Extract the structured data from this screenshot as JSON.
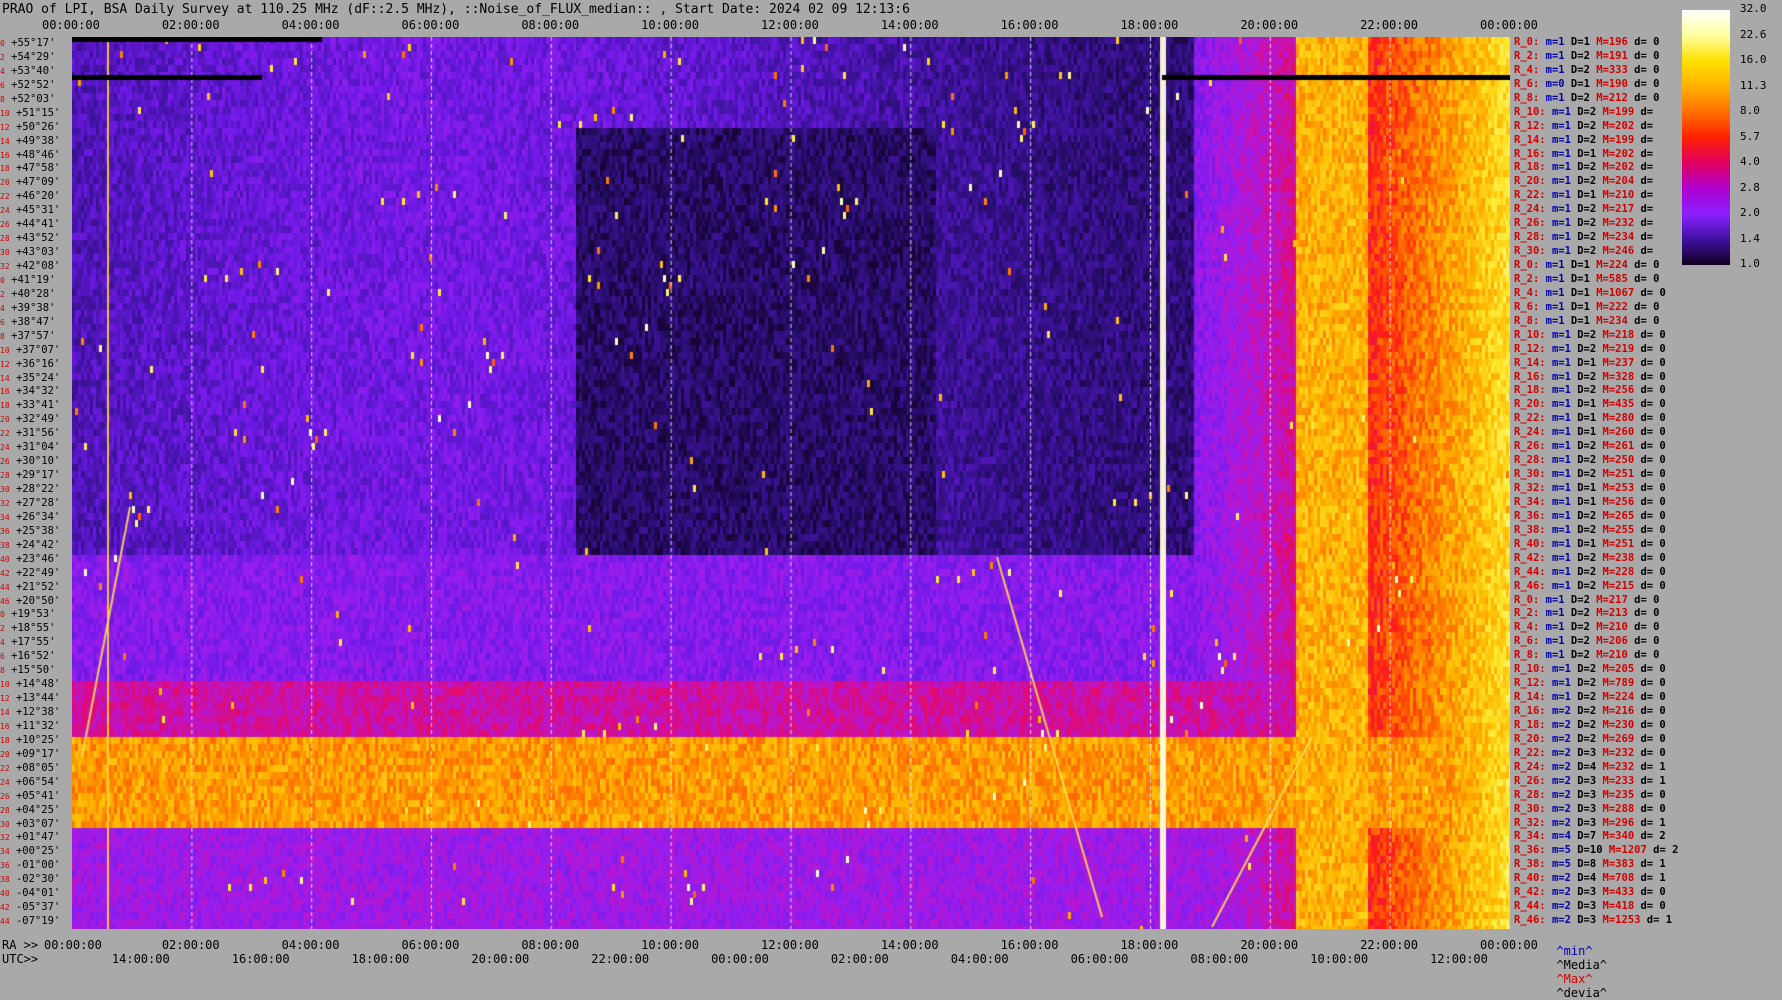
{
  "title": "PRAO of LPI, BSA Daily Survey at 110.25 MHz (dF::2.5 MHz), ::Noise_of_FLUX_median:: , Start Date: 2024 02 09 12:13:6",
  "chart_data": {
    "type": "heatmap",
    "top_axis_ticks": [
      "00:00:00",
      "02:00:00",
      "04:00:00",
      "06:00:00",
      "08:00:00",
      "10:00:00",
      "12:00:00",
      "14:00:00",
      "16:00:00",
      "18:00:00",
      "20:00:00",
      "22:00:00",
      "00:00:00"
    ],
    "bottom_ra_prefix": "RA >>",
    "bottom_ra_ticks": [
      "00:00:00",
      "02:00:00",
      "04:00:00",
      "06:00:00",
      "08:00:00",
      "10:00:00",
      "12:00:00",
      "14:00:00",
      "16:00:00",
      "18:00:00",
      "20:00:00",
      "22:00:00",
      "00:00:00"
    ],
    "bottom_utc_prefix": "UTC>>",
    "bottom_utc_ticks": [
      "14:00:00",
      "16:00:00",
      "18:00:00",
      "20:00:00",
      "22:00:00",
      "00:00:00",
      "02:00:00",
      "04:00:00",
      "06:00:00",
      "08:00:00",
      "10:00:00",
      "12:00:00"
    ],
    "declination_labels": [
      "+55°17'",
      "+54°29'",
      "+53°40'",
      "+52°52'",
      "+52°03'",
      "+51°15'",
      "+50°26'",
      "+49°38'",
      "+48°46'",
      "+47°58'",
      "+47°09'",
      "+46°20'",
      "+45°31'",
      "+44°41'",
      "+43°52'",
      "+43°03'",
      "+42°08'",
      "+41°19'",
      "+40°28'",
      "+39°38'",
      "+38°47'",
      "+37°57'",
      "+37°07'",
      "+36°16'",
      "+35°24'",
      "+34°32'",
      "+33°41'",
      "+32°49'",
      "+31°56'",
      "+31°04'",
      "+30°10'",
      "+29°17'",
      "+28°22'",
      "+27°28'",
      "+26°34'",
      "+25°38'",
      "+24°42'",
      "+23°46'",
      "+22°49'",
      "+21°52'",
      "+20°50'",
      "+19°53'",
      "+18°55'",
      "+17°55'",
      "+16°52'",
      "+15°50'",
      "+14°48'",
      "+13°44'",
      "+12°38'",
      "+11°32'",
      "+10°25'",
      "+09°17'",
      "+08°05'",
      "+06°54'",
      "+05°41'",
      "+04°25'",
      "+03°07'",
      "+01°47'",
      "+00°25'",
      "-01°00'",
      "-02°30'",
      "-04°01'",
      "-05°37'",
      "-07°19'"
    ],
    "row_indices": [
      "0",
      "2",
      "4",
      "6",
      "8",
      "10",
      "12",
      "14",
      "16",
      "18",
      "20",
      "22",
      "24",
      "26",
      "28",
      "30",
      "32",
      "0",
      "2",
      "4",
      "6",
      "8",
      "10",
      "12",
      "14",
      "16",
      "18",
      "20",
      "22",
      "24",
      "26",
      "28",
      "30",
      "32",
      "34",
      "36",
      "38",
      "40",
      "42",
      "44",
      "46",
      "0",
      "2",
      "4",
      "6",
      "8",
      "10",
      "12",
      "14",
      "16",
      "18",
      "20",
      "22",
      "24",
      "26",
      "28",
      "30",
      "32",
      "34",
      "36",
      "38",
      "40",
      "42",
      "44",
      "46"
    ],
    "colorbar_ticks": [
      "32.0",
      "22.6",
      "16.0",
      "11.3",
      "8.0",
      "5.7",
      "4.0",
      "2.8",
      "2.0",
      "1.4",
      "1.0"
    ],
    "colorbar_colors": [
      "#ffffff",
      "#ffffa0",
      "#ffe000",
      "#ffb000",
      "#ff7000",
      "#ff2000",
      "#e00060",
      "#b000d0",
      "#8a20ff",
      "#4010a0",
      "#100020"
    ],
    "stats": [
      {
        "r": "R_0:",
        "m": "m=1",
        "d": "D=1",
        "M": "M=196",
        "dv": "d= 0"
      },
      {
        "r": "R_2:",
        "m": "m=1",
        "d": "D=2",
        "M": "M=191",
        "dv": "d= 0"
      },
      {
        "r": "R_4:",
        "m": "m=1",
        "d": "D=2",
        "M": "M=333",
        "dv": "d= 0"
      },
      {
        "r": "R_6:",
        "m": "m=0",
        "d": "D=1",
        "M": "M=190",
        "dv": "d= 0"
      },
      {
        "r": "R_8:",
        "m": "m=1",
        "d": "D=2",
        "M": "M=212",
        "dv": "d= 0"
      },
      {
        "r": "R_10:",
        "m": "m=1",
        "d": "D=2",
        "M": "M=199",
        "dv": "d="
      },
      {
        "r": "R_12:",
        "m": "m=1",
        "d": "D=2",
        "M": "M=202",
        "dv": "d="
      },
      {
        "r": "R_14:",
        "m": "m=1",
        "d": "D=2",
        "M": "M=199",
        "dv": "d="
      },
      {
        "r": "R_16:",
        "m": "m=1",
        "d": "D=1",
        "M": "M=202",
        "dv": "d="
      },
      {
        "r": "R_18:",
        "m": "m=1",
        "d": "D=2",
        "M": "M=202",
        "dv": "d="
      },
      {
        "r": "R_20:",
        "m": "m=1",
        "d": "D=2",
        "M": "M=204",
        "dv": "d="
      },
      {
        "r": "R_22:",
        "m": "m=1",
        "d": "D=1",
        "M": "M=210",
        "dv": "d="
      },
      {
        "r": "R_24:",
        "m": "m=1",
        "d": "D=2",
        "M": "M=217",
        "dv": "d="
      },
      {
        "r": "R_26:",
        "m": "m=1",
        "d": "D=2",
        "M": "M=232",
        "dv": "d="
      },
      {
        "r": "R_28:",
        "m": "m=1",
        "d": "D=2",
        "M": "M=234",
        "dv": "d="
      },
      {
        "r": "R_30:",
        "m": "m=1",
        "d": "D=2",
        "M": "M=246",
        "dv": "d="
      },
      {
        "r": "R_0:",
        "m": "m=1",
        "d": "D=1",
        "M": "M=224",
        "dv": "d= 0"
      },
      {
        "r": "R_2:",
        "m": "m=1",
        "d": "D=1",
        "M": "M=585",
        "dv": "d= 0"
      },
      {
        "r": "R_4:",
        "m": "m=1",
        "d": "D=1",
        "M": "M=1067",
        "dv": "d= 0"
      },
      {
        "r": "R_6:",
        "m": "m=1",
        "d": "D=1",
        "M": "M=222",
        "dv": "d= 0"
      },
      {
        "r": "R_8:",
        "m": "m=1",
        "d": "D=1",
        "M": "M=234",
        "dv": "d= 0"
      },
      {
        "r": "R_10:",
        "m": "m=1",
        "d": "D=2",
        "M": "M=218",
        "dv": "d= 0"
      },
      {
        "r": "R_12:",
        "m": "m=1",
        "d": "D=2",
        "M": "M=219",
        "dv": "d= 0"
      },
      {
        "r": "R_14:",
        "m": "m=1",
        "d": "D=1",
        "M": "M=237",
        "dv": "d= 0"
      },
      {
        "r": "R_16:",
        "m": "m=1",
        "d": "D=2",
        "M": "M=328",
        "dv": "d= 0"
      },
      {
        "r": "R_18:",
        "m": "m=1",
        "d": "D=2",
        "M": "M=256",
        "dv": "d= 0"
      },
      {
        "r": "R_20:",
        "m": "m=1",
        "d": "D=1",
        "M": "M=435",
        "dv": "d= 0"
      },
      {
        "r": "R_22:",
        "m": "m=1",
        "d": "D=1",
        "M": "M=280",
        "dv": "d= 0"
      },
      {
        "r": "R_24:",
        "m": "m=1",
        "d": "D=1",
        "M": "M=260",
        "dv": "d= 0"
      },
      {
        "r": "R_26:",
        "m": "m=1",
        "d": "D=2",
        "M": "M=261",
        "dv": "d= 0"
      },
      {
        "r": "R_28:",
        "m": "m=1",
        "d": "D=2",
        "M": "M=250",
        "dv": "d= 0"
      },
      {
        "r": "R_30:",
        "m": "m=1",
        "d": "D=2",
        "M": "M=251",
        "dv": "d= 0"
      },
      {
        "r": "R_32:",
        "m": "m=1",
        "d": "D=1",
        "M": "M=253",
        "dv": "d= 0"
      },
      {
        "r": "R_34:",
        "m": "m=1",
        "d": "D=1",
        "M": "M=256",
        "dv": "d= 0"
      },
      {
        "r": "R_36:",
        "m": "m=1",
        "d": "D=2",
        "M": "M=265",
        "dv": "d= 0"
      },
      {
        "r": "R_38:",
        "m": "m=1",
        "d": "D=2",
        "M": "M=255",
        "dv": "d= 0"
      },
      {
        "r": "R_40:",
        "m": "m=1",
        "d": "D=1",
        "M": "M=251",
        "dv": "d= 0"
      },
      {
        "r": "R_42:",
        "m": "m=1",
        "d": "D=2",
        "M": "M=238",
        "dv": "d= 0"
      },
      {
        "r": "R_44:",
        "m": "m=1",
        "d": "D=2",
        "M": "M=228",
        "dv": "d= 0"
      },
      {
        "r": "R_46:",
        "m": "m=1",
        "d": "D=2",
        "M": "M=215",
        "dv": "d= 0"
      },
      {
        "r": "R_0:",
        "m": "m=1",
        "d": "D=2",
        "M": "M=217",
        "dv": "d= 0"
      },
      {
        "r": "R_2:",
        "m": "m=1",
        "d": "D=2",
        "M": "M=213",
        "dv": "d= 0"
      },
      {
        "r": "R_4:",
        "m": "m=1",
        "d": "D=2",
        "M": "M=210",
        "dv": "d= 0"
      },
      {
        "r": "R_6:",
        "m": "m=1",
        "d": "D=2",
        "M": "M=206",
        "dv": "d= 0"
      },
      {
        "r": "R_8:",
        "m": "m=1",
        "d": "D=2",
        "M": "M=210",
        "dv": "d= 0"
      },
      {
        "r": "R_10:",
        "m": "m=1",
        "d": "D=2",
        "M": "M=205",
        "dv": "d= 0"
      },
      {
        "r": "R_12:",
        "m": "m=1",
        "d": "D=2",
        "M": "M=789",
        "dv": "d= 0"
      },
      {
        "r": "R_14:",
        "m": "m=1",
        "d": "D=2",
        "M": "M=224",
        "dv": "d= 0"
      },
      {
        "r": "R_16:",
        "m": "m=2",
        "d": "D=2",
        "M": "M=216",
        "dv": "d= 0"
      },
      {
        "r": "R_18:",
        "m": "m=2",
        "d": "D=2",
        "M": "M=230",
        "dv": "d= 0"
      },
      {
        "r": "R_20:",
        "m": "m=2",
        "d": "D=2",
        "M": "M=269",
        "dv": "d= 0"
      },
      {
        "r": "R_22:",
        "m": "m=2",
        "d": "D=3",
        "M": "M=232",
        "dv": "d= 0"
      },
      {
        "r": "R_24:",
        "m": "m=2",
        "d": "D=4",
        "M": "M=232",
        "dv": "d= 1"
      },
      {
        "r": "R_26:",
        "m": "m=2",
        "d": "D=3",
        "M": "M=233",
        "dv": "d= 1"
      },
      {
        "r": "R_28:",
        "m": "m=2",
        "d": "D=3",
        "M": "M=235",
        "dv": "d= 0"
      },
      {
        "r": "R_30:",
        "m": "m=2",
        "d": "D=3",
        "M": "M=288",
        "dv": "d= 0"
      },
      {
        "r": "R_32:",
        "m": "m=2",
        "d": "D=3",
        "M": "M=296",
        "dv": "d= 1"
      },
      {
        "r": "R_34:",
        "m": "m=4",
        "d": "D=7",
        "M": "M=340",
        "dv": "d= 2"
      },
      {
        "r": "R_36:",
        "m": "m=5",
        "d": "D=10",
        "M": "M=1207",
        "dv": "d= 2"
      },
      {
        "r": "R_38:",
        "m": "m=5",
        "d": "D=8",
        "M": "M=383",
        "dv": "d= 1"
      },
      {
        "r": "R_40:",
        "m": "m=2",
        "d": "D=4",
        "M": "M=708",
        "dv": "d= 1"
      },
      {
        "r": "R_42:",
        "m": "m=2",
        "d": "D=3",
        "M": "M=433",
        "dv": "d= 0"
      },
      {
        "r": "R_44:",
        "m": "m=2",
        "d": "D=3",
        "M": "M=418",
        "dv": "d= 0"
      },
      {
        "r": "R_46:",
        "m": "m=2",
        "d": "D=3",
        "M": "M=1253",
        "dv": "d= 1"
      }
    ],
    "legend": {
      "min": "^min^",
      "median": "^Media^",
      "max": "^Max^",
      "devia": "^devia^"
    }
  },
  "colors": {
    "background": "#a9a9a9",
    "red_text": "#d40000",
    "blue_text": "#0000b0",
    "grid": "#ffffff"
  }
}
